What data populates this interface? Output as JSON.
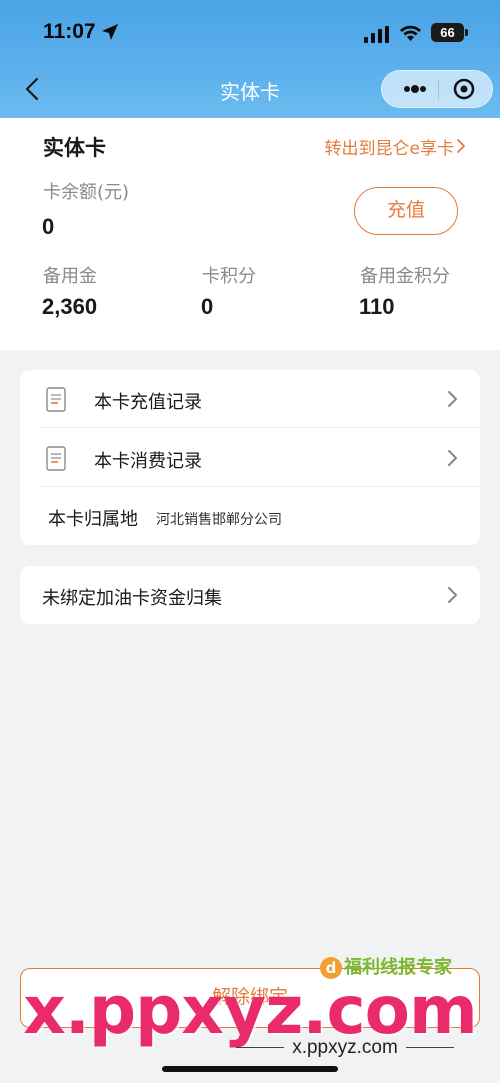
{
  "status_bar": {
    "time": "11:07",
    "battery": "66"
  },
  "nav": {
    "title": "实体卡"
  },
  "card": {
    "title": "实体卡",
    "transfer_link": "转出到昆仑e享卡",
    "balance_label": "卡余额(元)",
    "balance_value": "0",
    "recharge_button": "充值",
    "reserve_label": "备用金",
    "reserve_value": "2,360",
    "points_label": "卡积分",
    "points_value": "0",
    "reserve_points_label": "备用金积分",
    "reserve_points_value": "110"
  },
  "records": {
    "recharge_record": "本卡充值记录",
    "consume_record": "本卡消费记录",
    "owner_label": "本卡归属地",
    "owner_value": "河北销售邯郸分公司"
  },
  "collect": {
    "label": "未绑定加油卡资金归集"
  },
  "footer": {
    "unbind_button": "解除绑定"
  },
  "watermark": {
    "logo_text": "福利线报专家",
    "big_text": "x.ppxyz.com",
    "small_text": "x.ppxyz.com"
  },
  "colors": {
    "accent": "#e57c3c",
    "header": "#5cb0ec",
    "background": "#f1f2f4"
  }
}
